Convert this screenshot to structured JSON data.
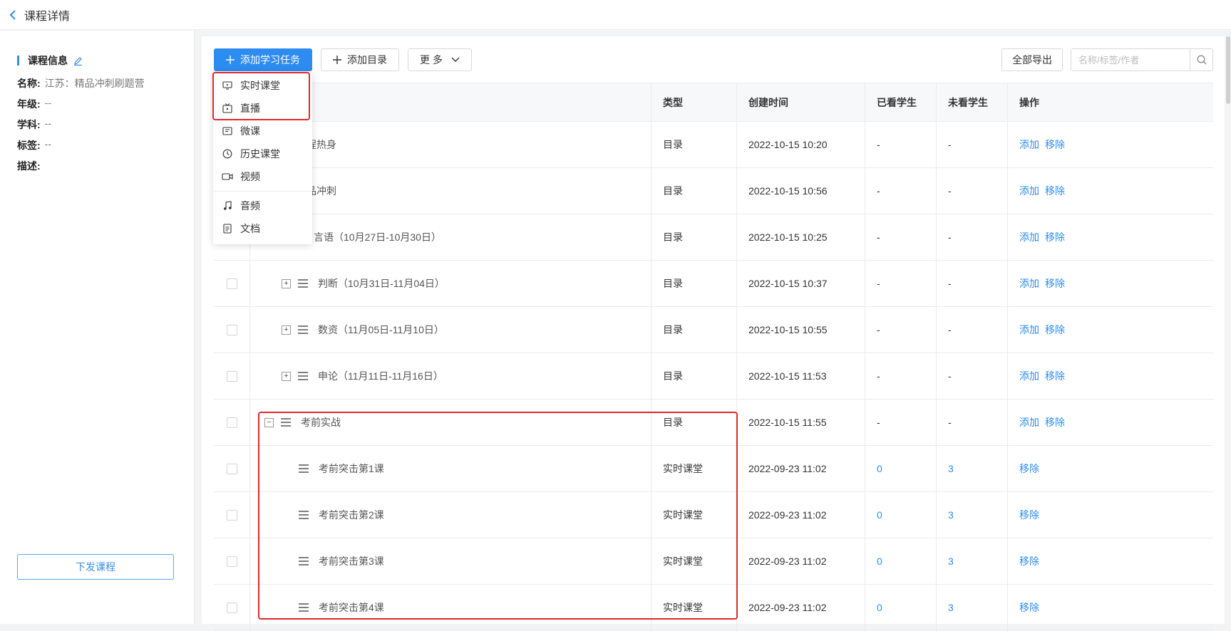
{
  "header": {
    "title": "课程详情"
  },
  "sidebar": {
    "info_title": "课程信息",
    "fields": [
      {
        "label": "名称:",
        "value": "江苏：精品冲刺刷题营"
      },
      {
        "label": "年级:",
        "value": "--"
      },
      {
        "label": "学科:",
        "value": "--"
      },
      {
        "label": "标签:",
        "value": "--"
      },
      {
        "label": "描述:",
        "value": ""
      }
    ],
    "dispatch_label": "下发课程"
  },
  "toolbar": {
    "add_task_label": "添加学习任务",
    "add_dir_label": "添加目录",
    "more_label": "更 多",
    "export_label": "全部导出",
    "search_placeholder": "名称/标签/作者"
  },
  "dropdown": {
    "items": [
      {
        "label": "实时课堂",
        "icon": "live-class-icon"
      },
      {
        "label": "直播",
        "icon": "live-tv-icon"
      },
      {
        "label": "微课",
        "icon": "micro-lesson-icon"
      },
      {
        "label": "历史课堂",
        "icon": "clock-icon"
      },
      {
        "label": "视频",
        "icon": "video-icon"
      },
      {
        "label": "音频",
        "icon": "music-note-icon"
      },
      {
        "label": "文档",
        "icon": "document-icon"
      }
    ]
  },
  "table": {
    "headers": [
      "类型",
      "创建时间",
      "已看学生",
      "未看学生",
      "操作"
    ],
    "rows": [
      {
        "name": "程热身",
        "type": "目录",
        "time": "2022-10-15 10:20",
        "seen": "-",
        "unseen": "-",
        "ops": [
          "添加",
          "移除"
        ]
      },
      {
        "name": "品冲刺",
        "type": "目录",
        "time": "2022-10-15 10:56",
        "seen": "-",
        "unseen": "-",
        "ops": [
          "添加",
          "移除"
        ]
      },
      {
        "name": "言语（10月27日-10月30日）",
        "type": "目录",
        "time": "2022-10-15 10:25",
        "seen": "-",
        "unseen": "-",
        "ops": [
          "添加",
          "移除"
        ]
      },
      {
        "name": "判断（10月31日-11月04日）",
        "type": "目录",
        "time": "2022-10-15 10:37",
        "seen": "-",
        "unseen": "-",
        "ops": [
          "添加",
          "移除"
        ]
      },
      {
        "name": "数资（11月05日-11月10日）",
        "type": "目录",
        "time": "2022-10-15 10:55",
        "seen": "-",
        "unseen": "-",
        "ops": [
          "添加",
          "移除"
        ]
      },
      {
        "name": "申论（11月11日-11月16日）",
        "type": "目录",
        "time": "2022-10-15 11:53",
        "seen": "-",
        "unseen": "-",
        "ops": [
          "添加",
          "移除"
        ]
      },
      {
        "name": "考前实战",
        "type": "目录",
        "time": "2022-10-15 11:55",
        "seen": "-",
        "unseen": "-",
        "ops": [
          "添加",
          "移除"
        ]
      },
      {
        "name": "考前突击第1课",
        "type": "实时课堂",
        "time": "2022-09-23 11:02",
        "seen": "0",
        "unseen": "3",
        "ops": [
          "移除"
        ]
      },
      {
        "name": "考前突击第2课",
        "type": "实时课堂",
        "time": "2022-09-23 11:02",
        "seen": "0",
        "unseen": "3",
        "ops": [
          "移除"
        ]
      },
      {
        "name": "考前突击第3课",
        "type": "实时课堂",
        "time": "2022-09-23 11:02",
        "seen": "0",
        "unseen": "3",
        "ops": [
          "移除"
        ]
      },
      {
        "name": "考前突击第4课",
        "type": "实时课堂",
        "time": "2022-09-23 11:02",
        "seen": "0",
        "unseen": "3",
        "ops": [
          "移除"
        ]
      }
    ]
  },
  "colors": {
    "primary": "#2d8cf0",
    "highlight": "#e0282c"
  }
}
